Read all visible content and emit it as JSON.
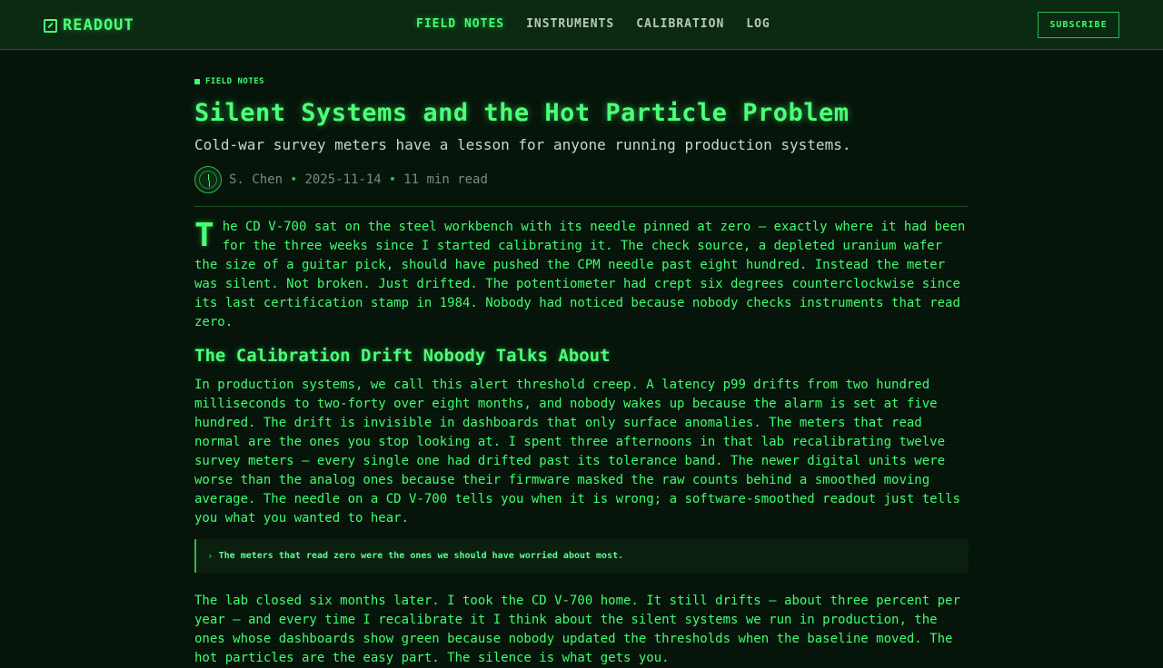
{
  "header": {
    "brand": "READOUT",
    "nav": [
      {
        "label": "FIELD NOTES",
        "active": true
      },
      {
        "label": "INSTRUMENTS",
        "active": false
      },
      {
        "label": "CALIBRATION",
        "active": false
      },
      {
        "label": "LOG",
        "active": false
      }
    ],
    "subscribe_label": "SUBSCRIBE"
  },
  "article": {
    "kicker": "FIELD NOTES",
    "title": "Silent Systems and the Hot Particle Problem",
    "subtitle": "Cold-war survey meters have a lesson for anyone running production systems.",
    "author": "S. Chen",
    "date": "2025-11-14",
    "read_time": "11 min read",
    "dropcap": "T",
    "paragraph1": "he CD V-700 sat on the steel workbench with its needle pinned at zero — exactly where it had been for the three weeks since I started calibrating it. The check source, a depleted uranium wafer the size of a guitar pick, should have pushed the CPM needle past eight hundred. Instead the meter was silent. Not broken. Just drifted. The potentiometer had crept six degrees counterclockwise since its last certification stamp in 1984. Nobody had noticed because nobody checks instruments that read zero.",
    "heading": "The Calibration Drift Nobody Talks About",
    "paragraph2": "In production systems, we call this alert threshold creep. A latency p99 drifts from two hundred milliseconds to two-forty over eight months, and nobody wakes up because the alarm is set at five hundred. The drift is invisible in dashboards that only surface anomalies. The meters that read normal are the ones you stop looking at. I spent three afternoons in that lab recalibrating twelve survey meters — every single one had drifted past its tolerance band. The newer digital units were worse than the analog ones because their firmware masked the raw counts behind a smoothed moving average. The needle on a CD V-700 tells you when it is wrong; a software-smoothed readout just tells you what you wanted to hear.",
    "pullquote": "The meters that read zero were the ones we should have worried about most.",
    "paragraph3": "The lab closed six months later. I took the CD V-700 home. It still drifts — about three percent per year — and every time I recalibrate it I think about the silent systems we run in production, the ones whose dashboards show green because nobody updated the thresholds when the baseline moved. The hot particles are the easy part. The silence is what gets you."
  },
  "colors": {
    "background": "#07160b",
    "accent": "#3dff6e",
    "muted": "#7a8a7d"
  }
}
